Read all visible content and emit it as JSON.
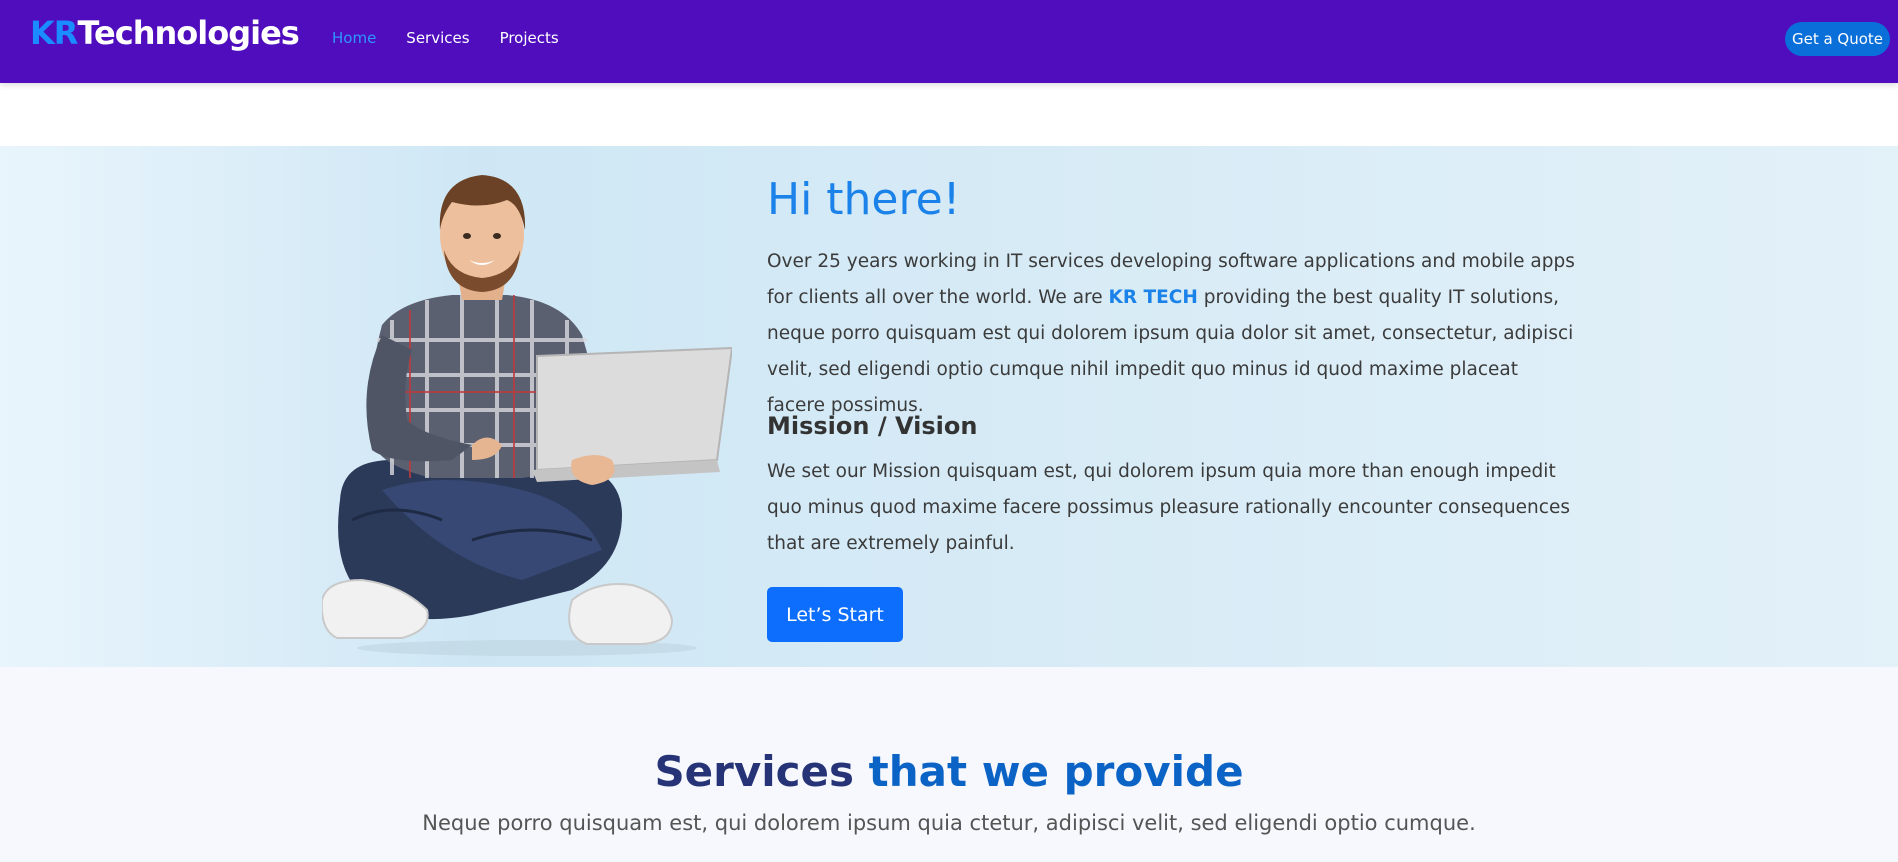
{
  "navbar": {
    "brand_kr": "KR",
    "brand_rest": "Technologies",
    "links": [
      "Home",
      "Services",
      "Projects"
    ],
    "active_link": "Home",
    "cta_label": "Get a Quote",
    "colors": {
      "background": "#4f0dbd",
      "brand_accent": "#1a8cff",
      "active_link": "#2f95ff",
      "cta": "#0a6fd9"
    }
  },
  "hero": {
    "title": "Hi there!",
    "intro_before": "Over 25 years working in IT services developing software applications and mobile apps for clients all over the world. We are ",
    "intro_highlight": "KR TECH",
    "intro_after": " providing the best quality IT solutions, neque porro quisquam est qui dolorem ipsum quia dolor sit amet, consectetur, adipisci velit, sed eligendi optio cumque nihil impedit quo minus id quod maxime placeat facere possimus.",
    "mission_title": "Mission / Vision",
    "mission_text": "We set our Mission quisquam est, qui dolorem ipsum quia more than enough impedit quo minus quod maxime facere possimus pleasure rationally encounter consequences that are extremely painful.",
    "button_label": "Let’s Start",
    "image": "man-with-laptop-photo",
    "colors": {
      "title": "#1a82e8",
      "button": "#0d6efd"
    }
  },
  "services": {
    "title_part1": "Services ",
    "title_part2": "that we provide",
    "subtitle": "Neque porro quisquam est, qui dolorem ipsum quia ctetur, adipisci velit, sed eligendi optio cumque.",
    "colors": {
      "title": "#263477",
      "accent": "#0b63c5"
    }
  }
}
